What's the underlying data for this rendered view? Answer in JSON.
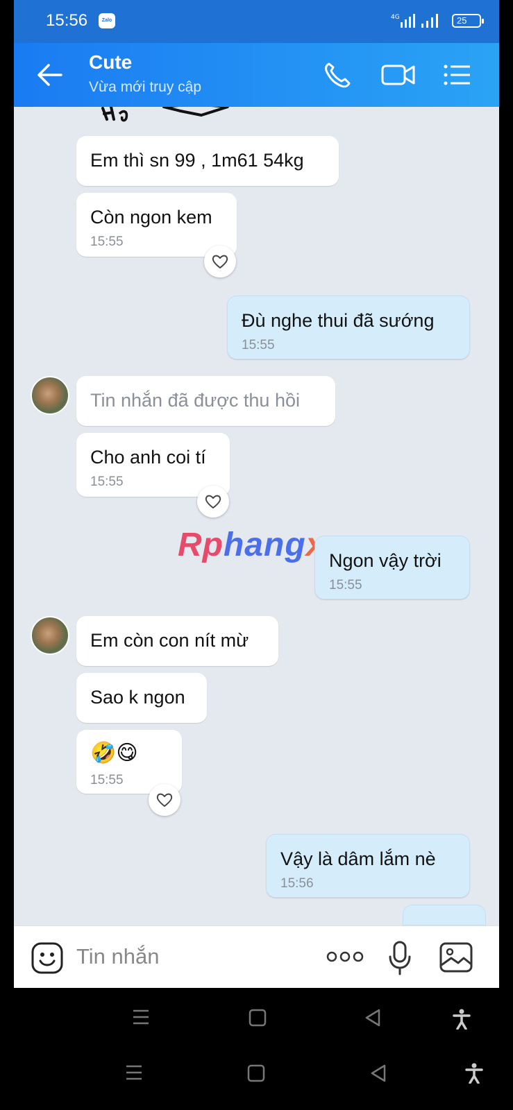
{
  "status_bar": {
    "time": "15:56",
    "app_badge": "Zalo",
    "network": "4G",
    "battery": "25"
  },
  "header": {
    "contact_name": "Cute",
    "presence": "Vừa mới truy cập"
  },
  "messages": [
    {
      "text": "Em thì sn 99 , 1m61 54kg"
    },
    {
      "text": "Còn ngon kem",
      "time": "15:55"
    },
    {
      "text": "Đù nghe thui đã sướng",
      "time": "15:55"
    },
    {
      "text": "Tin nhắn đã được thu hồi"
    },
    {
      "text": "Cho anh coi tí",
      "time": "15:55"
    },
    {
      "text": "Ngon vậy trời",
      "time": "15:55"
    },
    {
      "text": "Em còn con nít mừ"
    },
    {
      "text": "Sao k ngon"
    },
    {
      "text": "🤣😋",
      "time": "15:55"
    },
    {
      "text": "Vậy là dâm lắm nè",
      "time": "15:56"
    }
  ],
  "watermark": {
    "part1": "Rp",
    "part2": "hang",
    "part3": "x"
  },
  "input": {
    "placeholder": "Tin nhắn"
  },
  "colors": {
    "header": "#1a7bf2",
    "outgoing_bubble": "#d5ecfb",
    "incoming_bubble": "#ffffff",
    "chat_bg": "#e4e8ef"
  },
  "icons": [
    "back-arrow-icon",
    "phone-icon",
    "video-call-icon",
    "menu-list-icon",
    "sticker-smiley-icon",
    "more-dots-icon",
    "microphone-icon",
    "image-icon",
    "heart-icon"
  ]
}
